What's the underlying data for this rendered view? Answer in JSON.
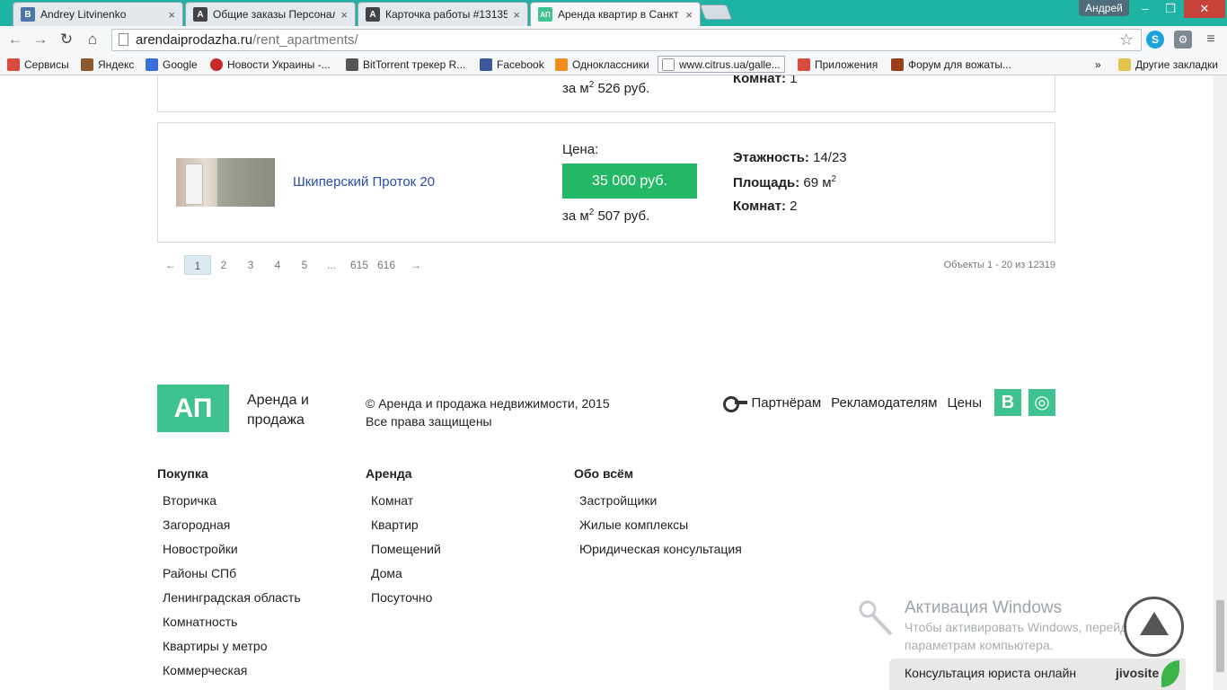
{
  "browser": {
    "tabs": [
      {
        "title": "Andrey Litvinenko",
        "icon": "vk-icon",
        "active": false
      },
      {
        "title": "Общие заказы Персонал",
        "icon": "a-icon",
        "active": false
      },
      {
        "title": "Карточка работы #13135",
        "icon": "a-icon",
        "active": false
      },
      {
        "title": "Аренда квартир в Санкт",
        "icon": "aфi-icon",
        "active": true
      }
    ],
    "tab_close": "×",
    "tab_fav_vk": "B",
    "tab_fav_a": "A",
    "tab_fav_site": "АП",
    "user": "Андрей",
    "window_buttons": {
      "minimize": "–",
      "restore": "❐",
      "close": "✕"
    },
    "url_host": "arendaiprodazha.ru",
    "url_path": "/rent_apartments/",
    "bookmarks": [
      {
        "label": "Сервисы",
        "color": "#d94b3c"
      },
      {
        "label": "Яндекс",
        "color": "#8a5a2b"
      },
      {
        "label": "Google",
        "color": "#3b6fd8"
      },
      {
        "label": "Новости Украины -...",
        "color": "#c42b2b"
      },
      {
        "label": "BitTorrent трекер R...",
        "color": "#555555"
      },
      {
        "label": "Facebook",
        "color": "#3b5998"
      },
      {
        "label": "Одноклассники",
        "color": "#f28c1b"
      },
      {
        "label": "www.citrus.ua/galle...",
        "color": "#cccccc"
      },
      {
        "label": "Приложения",
        "color": "#d94b3c"
      },
      {
        "label": "Форум для вожаты...",
        "color": "#9b3c1c"
      }
    ],
    "bookmarks_more": "»",
    "other_bookmarks": "Другие закладки"
  },
  "listings": [
    {
      "name": "",
      "price_label": "",
      "price": "",
      "per_m2_prefix": "за м",
      "per_m2_sup": "2",
      "per_m2_value": "526 руб.",
      "rooms_label": "Комнат:",
      "rooms": "1"
    },
    {
      "name": "Шкиперский Проток 20",
      "price_label": "Цена:",
      "price": "35 000 руб.",
      "per_m2_prefix": "за м",
      "per_m2_sup": "2",
      "per_m2_value": "507 руб.",
      "floors_label": "Этажность:",
      "floors": "14/23",
      "area_label": "Площадь:",
      "area": "69 м",
      "area_sup": "2",
      "rooms_label": "Комнат:",
      "rooms": "2"
    }
  ],
  "pager": {
    "prev": "←",
    "pages": [
      "1",
      "2",
      "3",
      "4",
      "5",
      "...",
      "615",
      "616"
    ],
    "current": "1",
    "next": "→",
    "info": "Объекты 1 - 20 из 12319"
  },
  "footer": {
    "logo": "АП",
    "brand_line1": "Аренда и",
    "brand_line2": "продажа",
    "copyright_line1": "© Аренда и продажа недвижимости, 2015",
    "copyright_line2": "Все права защищены",
    "links": [
      "Партнёрам",
      "Рекламодателям",
      "Цены"
    ],
    "social": [
      "В",
      "◎"
    ],
    "columns": [
      {
        "title": "Покупка",
        "items": [
          "Вторичка",
          "Загородная",
          "Новостройки",
          "Районы СПб",
          "Ленинградская область",
          "Комнатность",
          "Квартиры у метро",
          "Коммерческая"
        ]
      },
      {
        "title": "Аренда",
        "items": [
          "Комнат",
          "Квартир",
          "Помещений",
          "Дома",
          "Посуточно"
        ]
      },
      {
        "title": "Обо всём",
        "items": [
          "Застройщики",
          "Жилые комплексы",
          "Юридическая консультация"
        ]
      }
    ]
  },
  "overlay": {
    "activation_title": "Активация Windows",
    "activation_text1": "Чтобы активировать Windows, перейдите к",
    "activation_text2": "параметрам компьютера.",
    "chat_label": "Консультация юриста онлайн",
    "chat_brand": "jivosite"
  },
  "colors": {
    "tabbar": "#1fb3a4",
    "price_button": "#22b865",
    "logo": "#3ec28f",
    "link": "#2a4db0"
  }
}
